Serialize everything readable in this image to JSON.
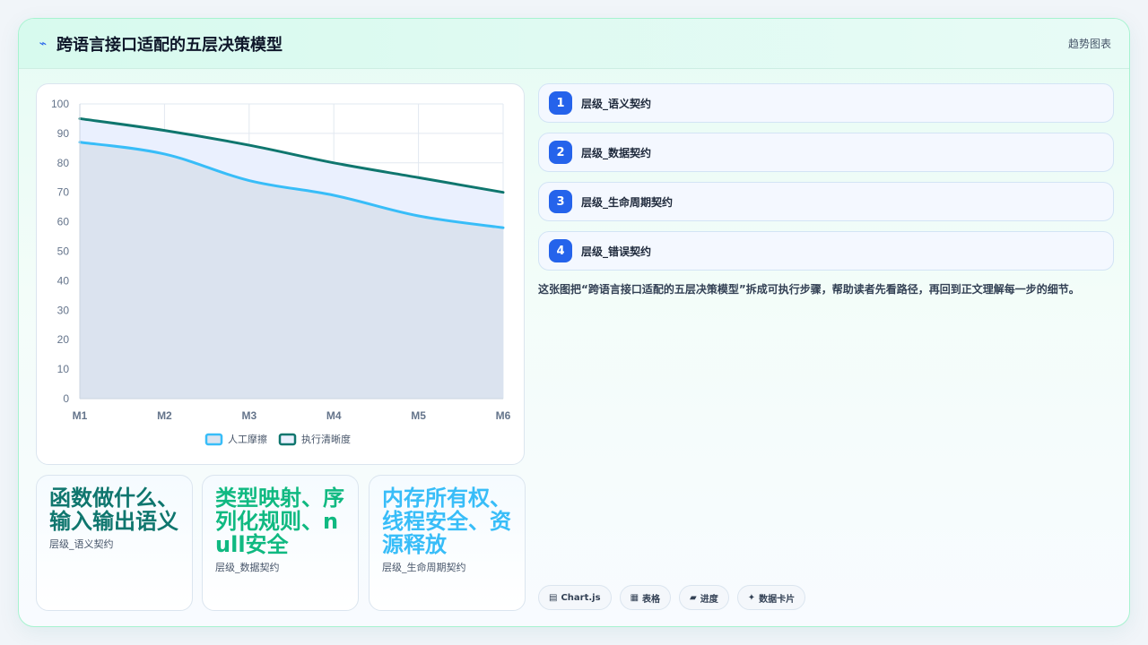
{
  "header": {
    "icon": "chart-line-icon",
    "title": "跨语言接口适配的五层决策模型",
    "right_label": "趋势图表"
  },
  "chart_data": {
    "type": "area",
    "x": [
      "M1",
      "M2",
      "M3",
      "M4",
      "M5",
      "M6"
    ],
    "series": [
      {
        "name": "人工摩擦",
        "values": [
          87,
          83,
          74,
          69,
          62,
          58
        ],
        "color": "#38bdf8",
        "fill": "#dbe3ef"
      },
      {
        "name": "执行清晰度",
        "values": [
          95,
          91,
          86,
          80,
          75,
          70
        ],
        "color": "#0f766e",
        "fill": "#eaf0fe"
      }
    ],
    "ylim": [
      0,
      100
    ],
    "yticks": [
      0,
      10,
      20,
      30,
      40,
      50,
      60,
      70,
      80,
      90,
      100
    ],
    "grid": true,
    "legend": "bottom"
  },
  "steps": [
    {
      "num": "1",
      "label": "层级_语义契约"
    },
    {
      "num": "2",
      "label": "层级_数据契约"
    },
    {
      "num": "3",
      "label": "层级_生命周期契约"
    },
    {
      "num": "4",
      "label": "层级_错误契约"
    }
  ],
  "description": "这张图把“跨语言接口适配的五层决策模型”拆成可执行步骤，帮助读者先看路径，再回到正文理解每一步的细节。",
  "stats": [
    {
      "value": "函数做什么、输入输出语义",
      "label": "层级_语义契约",
      "color": "#0f766e"
    },
    {
      "value": "类型映射、序列化规则、null安全",
      "label": "层级_数据契约",
      "color": "#10b981"
    },
    {
      "value": "内存所有权、线程安全、资源释放",
      "label": "层级_生命周期契约",
      "color": "#38bdf8"
    }
  ],
  "tags": [
    {
      "icon": "chart-icon",
      "glyph": "▤",
      "label": "Chart.js"
    },
    {
      "icon": "table-icon",
      "glyph": "▦",
      "label": "表格"
    },
    {
      "icon": "progress-icon",
      "glyph": "▰",
      "label": "进度"
    },
    {
      "icon": "sparkle-icon",
      "glyph": "✦",
      "label": "数据卡片"
    }
  ]
}
